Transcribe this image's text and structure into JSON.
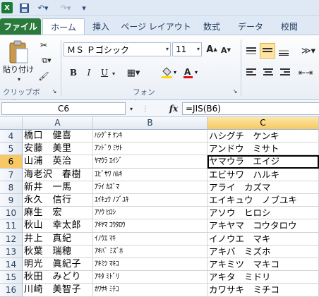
{
  "ribbon_tabs": [
    "ファイル",
    "ホーム",
    "挿入",
    "ページ レイアウト",
    "数式",
    "データ",
    "校閲"
  ],
  "clipboard": {
    "paste_label": "貼り付け",
    "group_label": "クリップボード"
  },
  "font": {
    "name": "ＭＳ Ｐゴシック",
    "size": "11",
    "group_label": "フォント",
    "bold": "B",
    "italic": "I",
    "underline": "U",
    "grow": "A",
    "shrink": "A"
  },
  "formula_bar": {
    "name_box": "C6",
    "fx": "fx",
    "formula": "=JIS(B6)"
  },
  "columns": [
    "A",
    "B",
    "C"
  ],
  "selected_column": "C",
  "active_row": "6",
  "rows": [
    {
      "num": "4",
      "a": "橋口　健喜",
      "b": "ﾊｼｸﾞﾁ ｹﾝｷ",
      "c": "ハシグチ　ケンキ"
    },
    {
      "num": "5",
      "a": "安藤　美里",
      "b": "ｱﾝﾄﾞｳ ﾐｻﾄ",
      "c": "アンドウ　ミサト"
    },
    {
      "num": "6",
      "a": "山浦　英治",
      "b": "ﾔﾏｳﾗ ｴｲｼﾞ",
      "c": "ヤマウラ　エイジ"
    },
    {
      "num": "7",
      "a": "海老沢　春樹",
      "b": "ｴﾋﾞｻﾜ ﾊﾙｷ",
      "c": "エビサワ　ハルキ"
    },
    {
      "num": "8",
      "a": "新井　一馬",
      "b": "ｱﾗｲ ｶｽﾞﾏ",
      "c": "アライ　カズマ"
    },
    {
      "num": "9",
      "a": "永久　信行",
      "b": "ｴｲｷｭｳ ﾉﾌﾞﾕｷ",
      "c": "エイキュウ　ノブユキ"
    },
    {
      "num": "10",
      "a": "麻生　宏",
      "b": "ｱｿｳ ﾋﾛｼ",
      "c": "アソウ　ヒロシ"
    },
    {
      "num": "11",
      "a": "秋山　幸太郎",
      "b": "ｱｷﾔﾏ ｺｳﾀﾛｳ",
      "c": "アキヤマ　コウタロウ"
    },
    {
      "num": "12",
      "a": "井上　真紀",
      "b": "ｲﾉｳｴ ﾏｷ",
      "c": "イノウエ　マキ"
    },
    {
      "num": "13",
      "a": "秋葉　瑞穂",
      "b": "ｱｷﾊﾞ ﾐｽﾞﾎ",
      "c": "アキバ　ミズホ"
    },
    {
      "num": "14",
      "a": "明光　眞紀子",
      "b": "ｱｷﾐﾂ ﾏｷｺ",
      "c": "アキミツ　マキコ"
    },
    {
      "num": "15",
      "a": "秋田　みどり",
      "b": "ｱｷﾀ ﾐﾄﾞﾘ",
      "c": "アキタ　ミドリ"
    },
    {
      "num": "16",
      "a": "川崎　美智子",
      "b": "ｶﾜｻｷ ﾐﾁｺ",
      "c": "カワサキ　ミチコ"
    }
  ],
  "colors": {
    "file_tab": "#2a7a3b",
    "selection_header": "#f7c863",
    "ribbon": "#dfe9f5"
  }
}
